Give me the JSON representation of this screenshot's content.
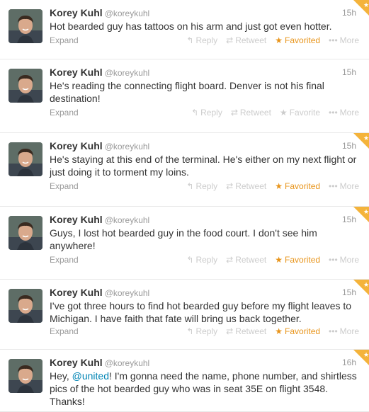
{
  "tweets": [
    {
      "name": "Korey Kuhl",
      "handle": "@koreykuhl",
      "time": "15h",
      "text_parts": [
        "Hot bearded guy has tattoos on his arm and just got even hotter."
      ],
      "expand": "Expand",
      "reply": "Reply",
      "retweet": "Retweet",
      "favorite": "Favorited",
      "favorited": true,
      "more": "More"
    },
    {
      "name": "Korey Kuhl",
      "handle": "@koreykuhl",
      "time": "15h",
      "text_parts": [
        "He's reading the connecting flight board. Denver is not his final destination!"
      ],
      "expand": "Expand",
      "reply": "Reply",
      "retweet": "Retweet",
      "favorite": "Favorite",
      "favorited": false,
      "more": "More"
    },
    {
      "name": "Korey Kuhl",
      "handle": "@koreykuhl",
      "time": "15h",
      "text_parts": [
        "He's staying at this end of the terminal. He's either on my next flight or just doing it to torment my loins."
      ],
      "expand": "Expand",
      "reply": "Reply",
      "retweet": "Retweet",
      "favorite": "Favorited",
      "favorited": true,
      "more": "More"
    },
    {
      "name": "Korey Kuhl",
      "handle": "@koreykuhl",
      "time": "15h",
      "text_parts": [
        "Guys, I lost hot bearded guy in the food court. I don't see him anywhere!"
      ],
      "expand": "Expand",
      "reply": "Reply",
      "retweet": "Retweet",
      "favorite": "Favorited",
      "favorited": true,
      "more": "More"
    },
    {
      "name": "Korey Kuhl",
      "handle": "@koreykuhl",
      "time": "15h",
      "text_parts": [
        "I've got three hours to find hot bearded guy before my flight leaves to Michigan. I have faith that fate will bring us back together."
      ],
      "expand": "Expand",
      "reply": "Reply",
      "retweet": "Retweet",
      "favorite": "Favorited",
      "favorited": true,
      "more": "More"
    },
    {
      "name": "Korey Kuhl",
      "handle": "@koreykuhl",
      "time": "16h",
      "text_parts": [
        "Hey, ",
        "@united",
        "! I'm gonna need the name, phone number, and shirtless pics of the hot bearded guy who was in seat 35E on flight 3548. Thanks!"
      ],
      "expand": "",
      "reply": "",
      "retweet": "",
      "favorite": "",
      "favorited": true,
      "more": ""
    }
  ],
  "colors": {
    "favorited": "#e8941a",
    "mention": "#0084b4",
    "muted": "#999999"
  },
  "icons": {
    "reply": "reply-arrow-icon",
    "retweet": "retweet-icon",
    "favorite": "star-icon",
    "more": "more-dots-icon"
  }
}
